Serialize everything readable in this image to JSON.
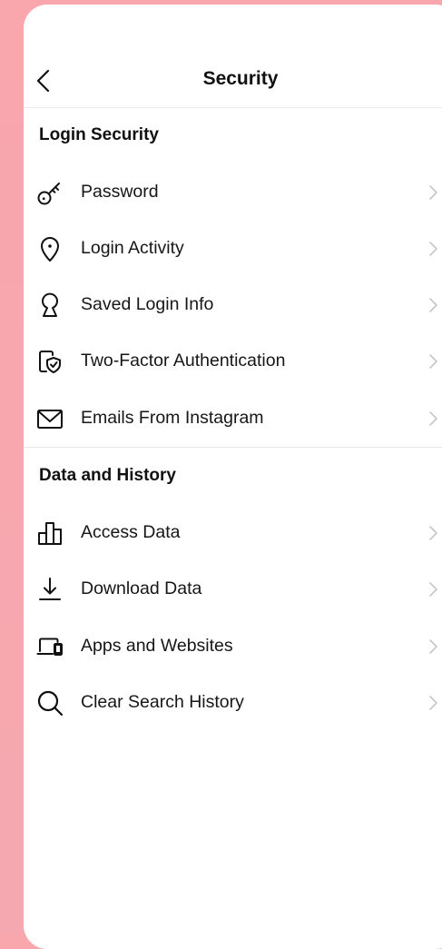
{
  "header": {
    "title": "Security",
    "back_icon": "chevron-left-icon"
  },
  "sections": [
    {
      "title": "Login Security",
      "items": [
        {
          "label": "Password",
          "icon": "key-icon"
        },
        {
          "label": "Login Activity",
          "icon": "location-pin-icon"
        },
        {
          "label": "Saved Login Info",
          "icon": "keyhole-icon"
        },
        {
          "label": "Two-Factor Authentication",
          "icon": "shield-device-icon"
        },
        {
          "label": "Emails From Instagram",
          "icon": "envelope-icon"
        }
      ]
    },
    {
      "title": "Data and History",
      "items": [
        {
          "label": "Access Data",
          "icon": "bar-chart-icon"
        },
        {
          "label": "Download Data",
          "icon": "download-icon"
        },
        {
          "label": "Apps and Websites",
          "icon": "devices-icon"
        },
        {
          "label": "Clear Search History",
          "icon": "search-icon"
        }
      ]
    }
  ],
  "colors": {
    "background": "#f9a6ad",
    "surface": "#ffffff",
    "text": "#161616",
    "chevron": "#c7c7c7",
    "divider": "#e6e6e6"
  }
}
